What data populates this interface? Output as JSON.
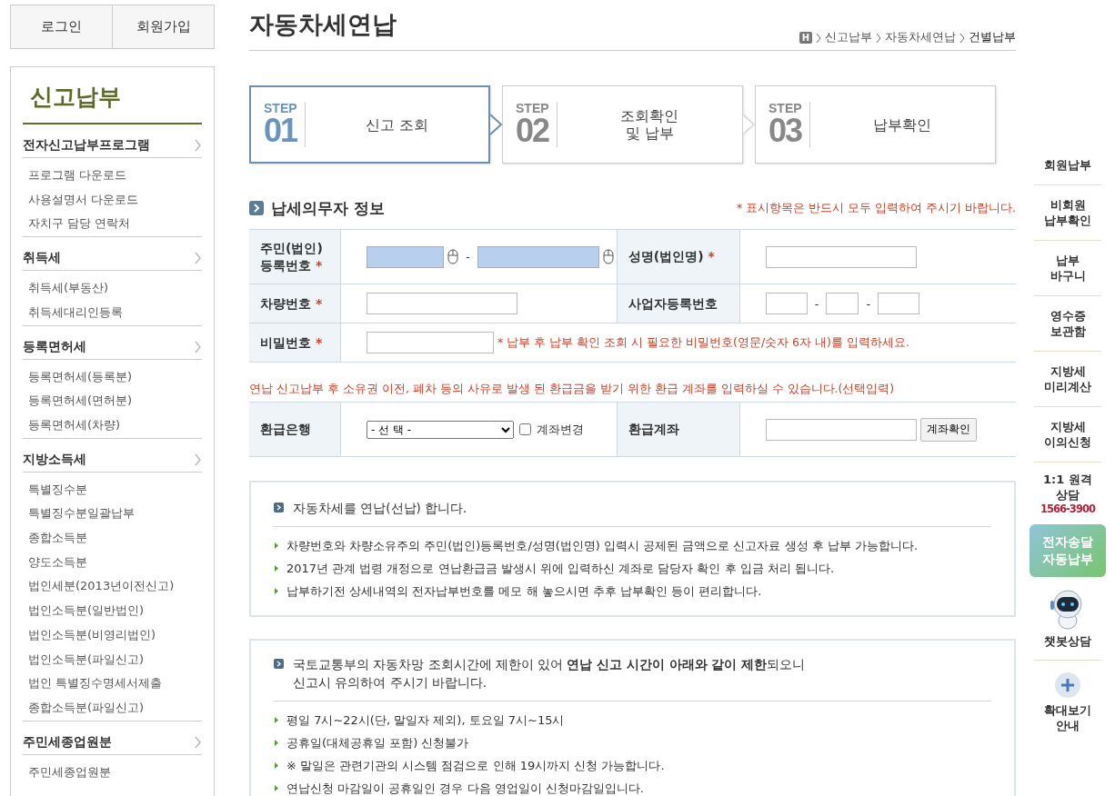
{
  "auth_buttons": [
    "로그인",
    "회원가입"
  ],
  "sidebar": {
    "title": "신고납부",
    "groups": [
      {
        "label": "전자신고납부프로그램",
        "children": [
          "프로그램 다운로드",
          "사용설명서 다운로드",
          "자치구 담당 연락처"
        ]
      },
      {
        "label": "취득세",
        "children": [
          "취득세(부동산)",
          "취득세대리인등록"
        ]
      },
      {
        "label": "등록면허세",
        "children": [
          "등록면허세(등록분)",
          "등록면허세(면허분)",
          "등록면허세(차량)"
        ]
      },
      {
        "label": "지방소득세",
        "children": [
          "특별징수분",
          "특별징수분일괄납부",
          "종합소득분",
          "양도소득분",
          "법인세분(2013년이전신고)",
          "법인소득분(일반법인)",
          "법인소득분(비영리법인)",
          "법인소득분(파일신고)",
          "법인 특별징수명세서제출",
          "종합소득분(파일신고)"
        ]
      },
      {
        "label": "주민세종업원분",
        "children": [
          "주민세종업원분"
        ]
      }
    ]
  },
  "page_title": "자동차세연납",
  "breadcrumb": {
    "home": "H",
    "items": [
      "신고납부",
      "자동차세연납",
      "건별납부"
    ]
  },
  "steps": [
    {
      "step": "STEP",
      "number": "01",
      "label": "신고 조회",
      "selected": true
    },
    {
      "step": "STEP",
      "number": "02",
      "label": "조회확인\n및 납부",
      "selected": false
    },
    {
      "step": "STEP",
      "number": "03",
      "label": "납부확인",
      "selected": false
    }
  ],
  "section_title": "납세의무자 정보",
  "required_note": "* 표시항목은 반드시 모두 입력하여 주시기 바랍니다.",
  "form_rows": [
    {
      "cells": [
        {
          "label": "주민(법인)\n등록번호",
          "required_mark": "*",
          "controls": [
            {
              "kind": "secure"
            },
            {
              "kind": "sep",
              "text": "-"
            },
            {
              "kind": "secure"
            }
          ]
        },
        {
          "label": "성명(법인명)",
          "required_mark": "*",
          "controls": [
            {
              "kind": "text"
            }
          ]
        }
      ]
    },
    {
      "cells": [
        {
          "label": "차량번호",
          "required_mark": "*",
          "controls": [
            {
              "kind": "text"
            }
          ]
        },
        {
          "label": "사업자등록번호",
          "controls": [
            {
              "kind": "text"
            },
            {
              "kind": "sep",
              "text": "-"
            },
            {
              "kind": "text"
            },
            {
              "kind": "sep",
              "text": "-"
            },
            {
              "kind": "text"
            }
          ]
        }
      ]
    },
    {
      "cells": [
        {
          "label": "비밀번호",
          "required_mark": "*",
          "controls": [
            {
              "kind": "text"
            },
            {
              "kind": "note",
              "text": "* 납부 후 납부 확인 조회 시 필요한 비밀번호(영문/숫자 6자 내)를 입력하세요."
            }
          ]
        }
      ]
    }
  ],
  "refund_note": "연납 신고납부 후 소유권 이전, 폐차 등의 사유로 발생 된 환급금을 받기 위한 환급 계좌를 입력하실 수 있습니다.(선택입력)",
  "refund_rows": [
    {
      "cells": [
        {
          "label": "환급은행",
          "controls": [
            {
              "kind": "select",
              "value": "- 선 택 -"
            },
            {
              "kind": "checkbox",
              "text": "계좌변경",
              "checked": false
            }
          ]
        },
        {
          "label": "환급계좌",
          "controls": [
            {
              "kind": "text"
            },
            {
              "kind": "button",
              "text": "계좌확인"
            }
          ]
        }
      ]
    }
  ],
  "info_boxes": [
    {
      "heading": "자동차세를 연납(선납) 합니다.",
      "items": [
        "차량번호와 차량소유주의 주민(법인)등록번호/성명(법인명) 입력시 공제된 금액으로 신고자료 생성 후 납부 가능합니다.",
        "2017년 관계 법령 개정으로 연납환급금 발생시 위에 입력하신 계좌로 담당자 확인 후 입금 처리 됩니다.",
        "납부하기전 상세내역의 전자납부번호를 메모 해 놓으시면 추후 납부확인 등이 편리합니다."
      ]
    },
    {
      "heading": "국토교통부의 자동차망 조회시간에 제한이 있어 **연납 신고 시간이 아래와 같이 제한**되오니\n신고시 유의하여 주시기 바랍니다.",
      "items": [
        "평일 7시~22시(단, 말일자 제외), 토요일 7시~15시",
        "공휴일(대체공휴일 포함) 신청불가",
        "※ 말일은 관련기관의 시스템 점검으로 인해 19시까지 신청 가능합니다.",
        "연납신청 마감일이 공휴일인 경우 다음 영업일이 신청마감일입니다."
      ]
    }
  ],
  "quick_menu": [
    {
      "kind": "link",
      "text": "회원납부"
    },
    {
      "kind": "link",
      "text": "비회원\n납부확인"
    },
    {
      "kind": "link",
      "text": "납부\n바구니"
    },
    {
      "kind": "link",
      "text": "영수증\n보관함"
    },
    {
      "kind": "link",
      "text": "지방세\n미리계산"
    },
    {
      "kind": "link",
      "text": "지방세\n이의신청"
    },
    {
      "kind": "phone",
      "text": "1:1 원격\n상담",
      "phone": "1566-3900"
    },
    {
      "kind": "banner",
      "text": "전자송달\n자동납부"
    },
    {
      "kind": "chatbot",
      "text": "챗봇상담"
    },
    {
      "kind": "zoom",
      "text": "확대보기\n안내"
    }
  ]
}
